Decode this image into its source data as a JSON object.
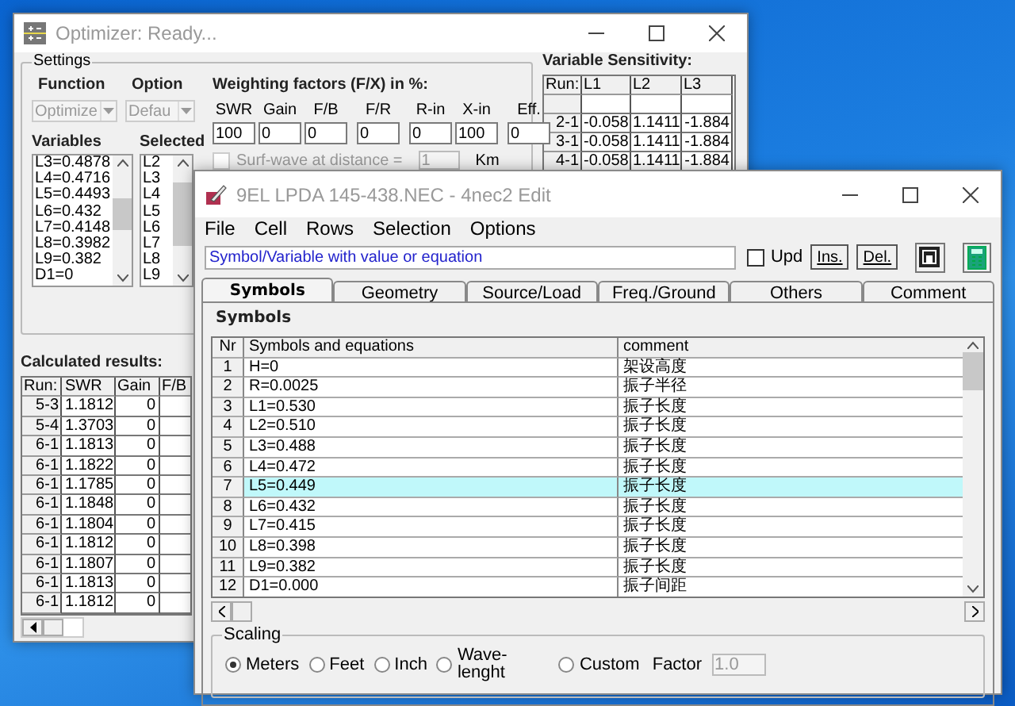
{
  "optimizer": {
    "title": "Optimizer: Ready...",
    "settings": {
      "label": "Settings",
      "function": {
        "label": "Function",
        "value": "Optimize"
      },
      "option": {
        "label": "Option",
        "value": "Defau"
      },
      "weighting": {
        "label": "Weighting factors (F/X) in %:",
        "factors": [
          {
            "label": "SWR",
            "value": "100"
          },
          {
            "label": "Gain",
            "value": "0"
          },
          {
            "label": "F/B",
            "value": "0"
          },
          {
            "label": "F/R",
            "value": "0"
          },
          {
            "label": "R-in",
            "value": "0"
          },
          {
            "label": "X-in",
            "value": "100"
          },
          {
            "label": "Eff.",
            "value": "0"
          }
        ]
      },
      "surf_wave": {
        "label": "Surf-wave at distance =",
        "checked": false,
        "disabled": true,
        "value": "1",
        "unit": "Km"
      },
      "variables": {
        "label": "Variables",
        "items": [
          "L3=0.4878",
          "L4=0.4716",
          "L5=0.4493",
          "L6=0.432",
          "L7=0.4148",
          "L8=0.3982",
          "L9=0.382",
          "D1=0"
        ]
      },
      "selected": {
        "label": "Selected",
        "items": [
          "L2",
          "L3",
          "L4",
          "L5",
          "L6",
          "L7",
          "L8",
          "L9"
        ]
      }
    },
    "results": {
      "label": "Calculated results:",
      "columns": [
        "Run:",
        "SWR",
        "Gain",
        "F/B"
      ],
      "rows": [
        [
          "5-3",
          "1.1812",
          "0"
        ],
        [
          "5-4",
          "1.3703",
          "0"
        ],
        [
          "6-1",
          "1.1813",
          "0"
        ],
        [
          "6-1",
          "1.1822",
          "0"
        ],
        [
          "6-1",
          "1.1785",
          "0"
        ],
        [
          "6-1",
          "1.1848",
          "0"
        ],
        [
          "6-1",
          "1.1804",
          "0"
        ],
        [
          "6-1",
          "1.1812",
          "0"
        ],
        [
          "6-1",
          "1.1807",
          "0"
        ],
        [
          "6-1",
          "1.1813",
          "0"
        ],
        [
          "6-1",
          "1.1812",
          "0"
        ]
      ]
    },
    "sensitivity": {
      "label": "Variable Sensitivity:",
      "columns": [
        "Run:",
        "L1",
        "L2",
        "L3"
      ],
      "rows": [
        [
          "2-1",
          "-0.058",
          "1.1411",
          "-1.884"
        ],
        [
          "3-1",
          "-0.058",
          "1.1411",
          "-1.884"
        ],
        [
          "4-1",
          "-0.058",
          "1.1411",
          "-1.884"
        ]
      ]
    }
  },
  "edit": {
    "title": "9EL LPDA 145-438.NEC - 4nec2 Edit",
    "menu": [
      "File",
      "Cell",
      "Rows",
      "Selection",
      "Options"
    ],
    "hint_field": {
      "value": "Symbol/Variable with value or equation"
    },
    "upd": {
      "label": "Upd",
      "checked": false
    },
    "buttons": [
      "Ins.",
      "Del."
    ],
    "tabs": [
      {
        "label": "Symbols",
        "selected": true
      },
      {
        "label": "Geometry",
        "selected": false
      },
      {
        "label": "Source/Load",
        "selected": false
      },
      {
        "label": "Freq./Ground",
        "selected": false
      },
      {
        "label": "Others",
        "selected": false
      },
      {
        "label": "Comment",
        "selected": false
      }
    ],
    "panel_label": "Symbols",
    "table": {
      "columns": [
        "Nr",
        "Symbols and equations",
        "comment"
      ],
      "rows": [
        {
          "nr": "1",
          "symbol": "H=0",
          "comment": "架设高度",
          "selected": false
        },
        {
          "nr": "2",
          "symbol": "R=0.0025",
          "comment": "振子半径",
          "selected": false
        },
        {
          "nr": "3",
          "symbol": "L1=0.530",
          "comment": "振子长度",
          "selected": false
        },
        {
          "nr": "4",
          "symbol": "L2=0.510",
          "comment": "振子长度",
          "selected": false
        },
        {
          "nr": "5",
          "symbol": "L3=0.488",
          "comment": "振子长度",
          "selected": false
        },
        {
          "nr": "6",
          "symbol": "L4=0.472",
          "comment": "振子长度",
          "selected": false
        },
        {
          "nr": "7",
          "symbol": "L5=0.449",
          "comment": "振子长度",
          "selected": true
        },
        {
          "nr": "8",
          "symbol": "L6=0.432",
          "comment": "振子长度",
          "selected": false
        },
        {
          "nr": "9",
          "symbol": "L7=0.415",
          "comment": "振子长度",
          "selected": false
        },
        {
          "nr": "10",
          "symbol": "L8=0.398",
          "comment": "振子长度",
          "selected": false
        },
        {
          "nr": "11",
          "symbol": "L9=0.382",
          "comment": "振子长度",
          "selected": false
        },
        {
          "nr": "12",
          "symbol": "D1=0.000",
          "comment": "振子间距",
          "selected": false
        }
      ]
    },
    "scaling": {
      "label": "Scaling",
      "units": [
        {
          "label": "Meters",
          "selected": true
        },
        {
          "label": "Feet",
          "selected": false
        },
        {
          "label": "Inch",
          "selected": false
        },
        {
          "label": "Wave-lenght",
          "selected": false
        },
        {
          "label": "Custom",
          "selected": false
        }
      ],
      "factor": {
        "label": "Factor",
        "value": "1.0",
        "disabled": true
      }
    }
  }
}
